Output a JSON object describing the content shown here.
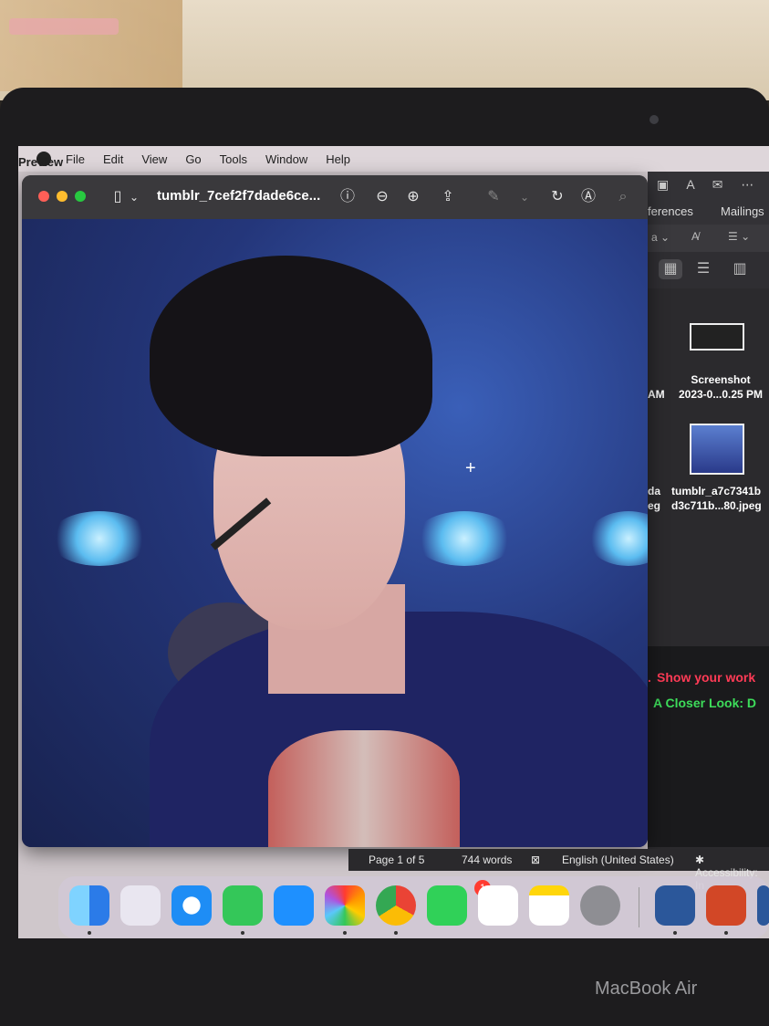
{
  "menubar": {
    "app_name": "Preview",
    "items": [
      "File",
      "Edit",
      "View",
      "Go",
      "Tools",
      "Window",
      "Help"
    ]
  },
  "preview": {
    "filename": "tumblr_7cef2f7dade6ce..."
  },
  "word": {
    "tabs": {
      "references": "ferences",
      "mailings": "Mailings"
    },
    "files": [
      {
        "line1": "Screenshot",
        "line2": "2023-0...0.25 PM",
        "side1": "AM",
        "side2": ""
      },
      {
        "line1": "tumblr_a7c7341b",
        "line2": "d3c711b...80.jpeg",
        "side1": "da",
        "side2": "eg"
      }
    ],
    "status": {
      "page": "Page 1 of 5",
      "words": "744 words",
      "language": "English (United States)",
      "accessibility": "Accessibility: In"
    }
  },
  "terminal": {
    "line1": "Show your work",
    "line2": "A Closer Look:  D",
    "prefix": "."
  },
  "dock": {
    "facetime_badge": "1"
  },
  "laptop": {
    "brand": "MacBook Air"
  }
}
